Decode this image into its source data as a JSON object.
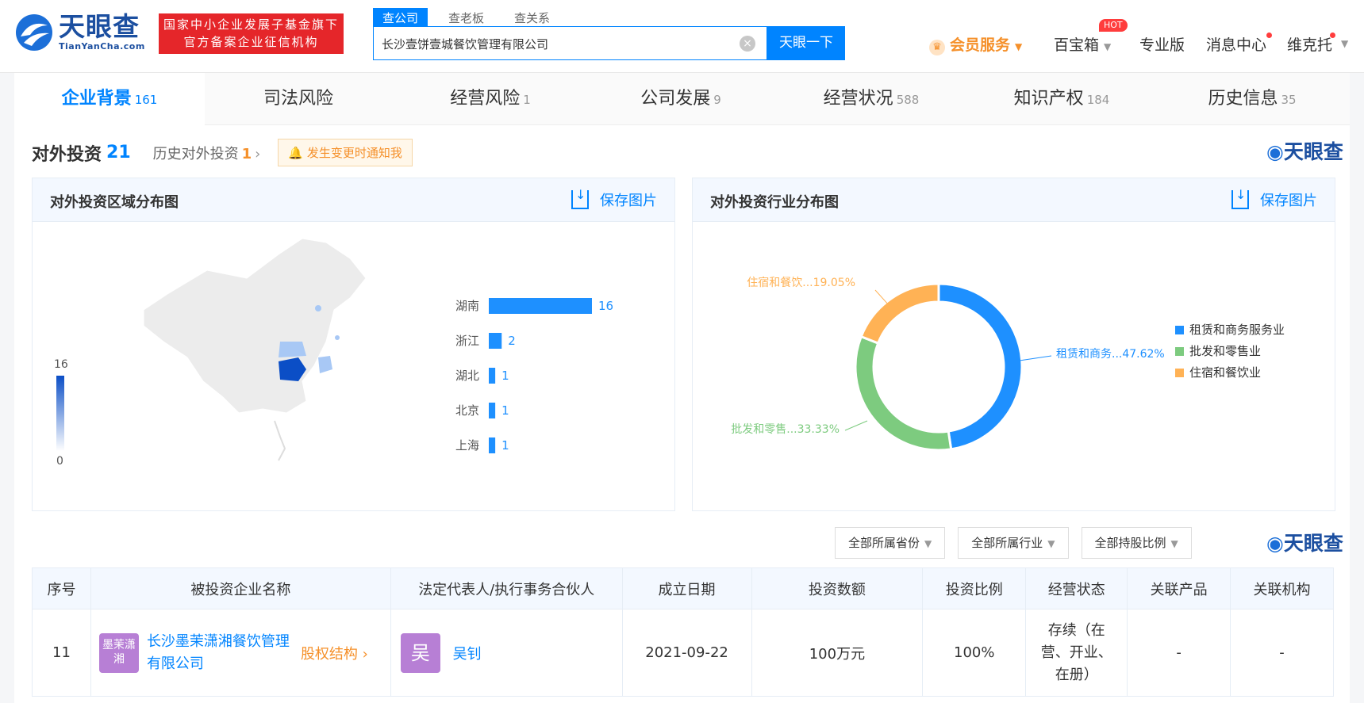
{
  "header": {
    "logo_cn": "天眼查",
    "logo_en": "TianYanCha.com",
    "banner_line1": "国家中小企业发展子基金旗下",
    "banner_line2": "官方备案企业征信机构",
    "search_tabs": [
      "查公司",
      "查老板",
      "查关系"
    ],
    "search_value": "长沙壹饼壹城餐饮管理有限公司",
    "search_button": "天眼一下",
    "nav": {
      "vip": "会员服务",
      "toolbox": "百宝箱",
      "hot": "HOT",
      "pro": "专业版",
      "messages": "消息中心",
      "user": "维克托"
    }
  },
  "tabs": [
    {
      "label": "企业背景",
      "count": "161"
    },
    {
      "label": "司法风险",
      "count": ""
    },
    {
      "label": "经营风险",
      "count": "1"
    },
    {
      "label": "公司发展",
      "count": "9"
    },
    {
      "label": "经营状况",
      "count": "588"
    },
    {
      "label": "知识产权",
      "count": "184"
    },
    {
      "label": "历史信息",
      "count": "35"
    }
  ],
  "section": {
    "title": "对外投资",
    "count": "21",
    "history_label": "历史对外投资",
    "history_count": "1",
    "notify": "发生变更时通知我",
    "watermark": "天眼查"
  },
  "region_panel": {
    "title": "对外投资区域分布图",
    "save": "保存图片",
    "legend_max": "16",
    "legend_min": "0"
  },
  "industry_panel": {
    "title": "对外投资行业分布图",
    "save": "保存图片"
  },
  "chart_data": [
    {
      "type": "bar",
      "categories": [
        "湖南",
        "浙江",
        "湖北",
        "北京",
        "上海"
      ],
      "values": [
        16,
        2,
        1,
        1,
        1
      ],
      "color": "#1e90ff"
    },
    {
      "type": "pie",
      "categories": [
        "租赁和商务服务业",
        "批发和零售业",
        "住宿和餐饮业"
      ],
      "values": [
        47.62,
        33.33,
        19.05
      ],
      "labels": [
        "租赁和商务...47.62%",
        "批发和零售...33.33%",
        "住宿和餐饮...19.05%"
      ],
      "colors": [
        "#1e90ff",
        "#7dcb7f",
        "#ffb255"
      ],
      "legend": "right"
    }
  ],
  "filters": [
    "全部所属省份",
    "全部所属行业",
    "全部持股比例"
  ],
  "table": {
    "headers": [
      "序号",
      "被投资企业名称",
      "法定代表人/执行事务合伙人",
      "成立日期",
      "投资数额",
      "投资比例",
      "经营状态",
      "关联产品",
      "关联机构"
    ],
    "rows": [
      {
        "index": "11",
        "badge": "墨茉潇湘",
        "company": "长沙墨茉潇湘餐饮管理有限公司",
        "equity": "股权结构",
        "person_badge": "吴",
        "person": "吴钊",
        "date": "2021-09-22",
        "amount": "100万元",
        "ratio": "100%",
        "status": "存续（在营、开业、在册）",
        "product": "-",
        "org": "-"
      }
    ]
  }
}
